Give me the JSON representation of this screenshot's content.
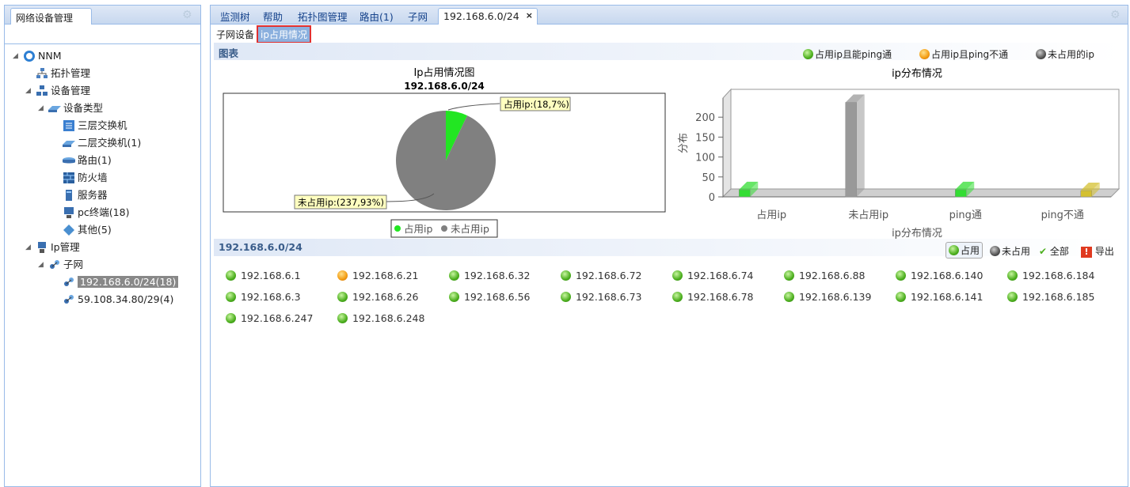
{
  "left_panel": {
    "title": "网络设备管理"
  },
  "tree": {
    "root": "NNM",
    "topo": "拓扑管理",
    "device_mgmt": "设备管理",
    "device_type": "设备类型",
    "l3": "三层交换机",
    "l2": "二层交换机(1)",
    "router": "路由(1)",
    "firewall": "防火墙",
    "server": "服务器",
    "pc": "pc终端(18)",
    "other": "其他(5)",
    "ip_mgmt": "Ip管理",
    "subnet": "子网",
    "sub1": "192.168.6.0/24(18)",
    "sub2": "59.108.34.80/29(4)"
  },
  "tabs": [
    "监测树",
    "帮助",
    "拓扑图管理",
    "路由(1)",
    "子网"
  ],
  "active_tab": "192.168.6.0/24",
  "subtabs": {
    "subnet_device": "子网设备",
    "ip_usage": "ip占用情况"
  },
  "chart_section": "图表",
  "legend": {
    "a": "占用ip且能ping通",
    "b": "占用ip且ping不通",
    "c": "未占用的ip"
  },
  "chart_data": [
    {
      "type": "pie",
      "title": "Ip占用情况图",
      "subtitle": "192.168.6.0/24",
      "slices": [
        {
          "name": "占用ip",
          "value": 18,
          "pct": 7,
          "color": "#22e622"
        },
        {
          "name": "未占用ip",
          "value": 237,
          "pct": 93,
          "color": "#808080"
        }
      ],
      "labels": [
        "占用ip:(18,7%)",
        "未占用ip:(237,93%)"
      ],
      "legend": [
        "占用ip",
        "未占用ip"
      ]
    },
    {
      "type": "bar",
      "title": "ip分布情况",
      "categories": [
        "占用ip",
        "未占用ip",
        "ping通",
        "ping不通"
      ],
      "values": [
        18,
        237,
        18,
        0
      ],
      "colors": [
        "#33dd33",
        "#999999",
        "#33dd33",
        "#d4c030"
      ],
      "ylabel": "分布",
      "xlabel": "ip分布情况",
      "yticks": [
        0,
        50,
        100,
        150,
        200
      ],
      "ylim": [
        0,
        250
      ]
    }
  ],
  "ip_section": "192.168.6.0/24",
  "filters": {
    "used": "占用",
    "unused": "未占用",
    "all": "全部",
    "export": "导出"
  },
  "ips": [
    {
      "ip": "192.168.6.1",
      "s": "g"
    },
    {
      "ip": "192.168.6.21",
      "s": "o"
    },
    {
      "ip": "192.168.6.32",
      "s": "g"
    },
    {
      "ip": "192.168.6.72",
      "s": "g"
    },
    {
      "ip": "192.168.6.74",
      "s": "g"
    },
    {
      "ip": "192.168.6.88",
      "s": "g"
    },
    {
      "ip": "192.168.6.140",
      "s": "g"
    },
    {
      "ip": "192.168.6.184",
      "s": "g"
    },
    {
      "ip": "192.168.6.3",
      "s": "g"
    },
    {
      "ip": "192.168.6.26",
      "s": "g"
    },
    {
      "ip": "192.168.6.56",
      "s": "g"
    },
    {
      "ip": "192.168.6.73",
      "s": "g"
    },
    {
      "ip": "192.168.6.78",
      "s": "g"
    },
    {
      "ip": "192.168.6.139",
      "s": "g"
    },
    {
      "ip": "192.168.6.141",
      "s": "g"
    },
    {
      "ip": "192.168.6.185",
      "s": "g"
    },
    {
      "ip": "192.168.6.247",
      "s": "g"
    },
    {
      "ip": "192.168.6.248",
      "s": "g"
    }
  ]
}
